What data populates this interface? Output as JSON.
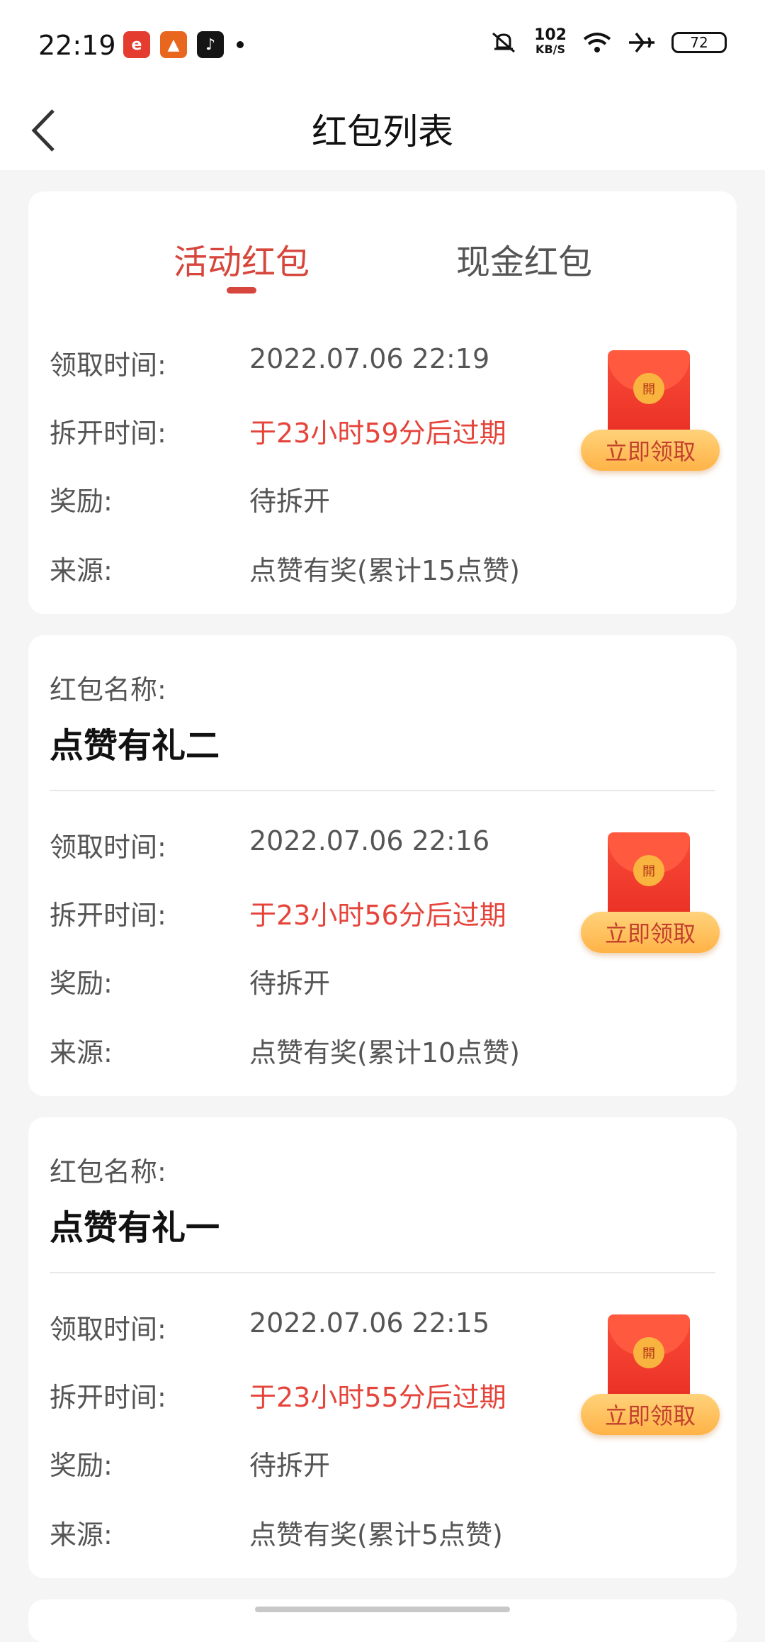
{
  "status_bar": {
    "time": "22:19",
    "apps": [
      "e-app-icon",
      "orange-app-icon",
      "tiktok-icon"
    ],
    "net_speed_value": "102",
    "net_speed_unit": "KB/S",
    "battery": "72"
  },
  "nav": {
    "title": "红包列表"
  },
  "tabs": [
    {
      "label": "活动红包",
      "active": true
    },
    {
      "label": "现金红包",
      "active": false
    }
  ],
  "colors": {
    "accent": "#d7463c",
    "expire": "#e5443b",
    "button": "#ffb347"
  },
  "labels": {
    "name": "红包名称:",
    "receive_time": "领取时间:",
    "open_time": "拆开时间:",
    "reward": "奖励:",
    "source": "来源:",
    "claim_button": "立即领取",
    "seal": "開"
  },
  "cards": [
    {
      "receive_time": "2022.07.06 22:19",
      "open_time": "于23小时59分后过期",
      "reward": "待拆开",
      "source": "点赞有奖(累计15点赞)"
    },
    {
      "name": "点赞有礼二",
      "receive_time": "2022.07.06 22:16",
      "open_time": "于23小时56分后过期",
      "reward": "待拆开",
      "source": "点赞有奖(累计10点赞)"
    },
    {
      "name": "点赞有礼一",
      "receive_time": "2022.07.06 22:15",
      "open_time": "于23小时55分后过期",
      "reward": "待拆开",
      "source": "点赞有奖(累计5点赞)"
    }
  ]
}
